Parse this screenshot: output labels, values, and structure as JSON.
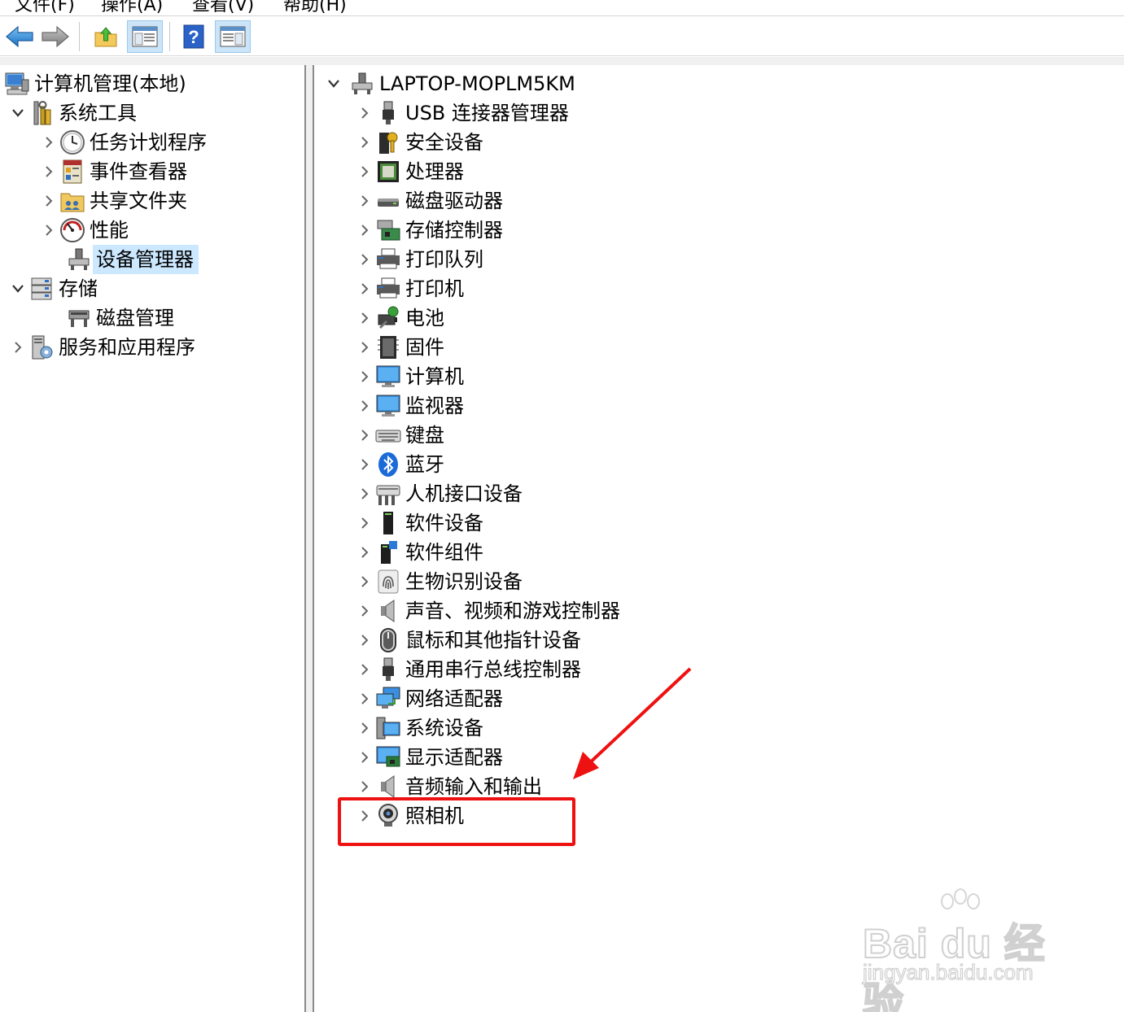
{
  "menu": {
    "items": [
      "文件(F)",
      "操作(A)",
      "查看(V)",
      "帮助(H)"
    ]
  },
  "toolbar": {
    "buttons": [
      {
        "icon": "back-arrow-icon",
        "pressed": false
      },
      {
        "icon": "forward-arrow-icon",
        "pressed": false
      },
      {
        "icon": "up-folder-icon",
        "pressed": false
      },
      {
        "icon": "show-hide-tree-icon",
        "pressed": true
      },
      {
        "icon": "help-icon",
        "pressed": false
      },
      {
        "icon": "action-pane-icon",
        "pressed": true
      }
    ]
  },
  "left_tree": {
    "root": "计算机管理(本地)",
    "system_tools": "系统工具",
    "task_scheduler": "任务计划程序",
    "event_viewer": "事件查看器",
    "shared_folders": "共享文件夹",
    "performance": "性能",
    "device_manager": "设备管理器",
    "storage": "存储",
    "disk_management": "磁盘管理",
    "services_apps": "服务和应用程序",
    "selected": "设备管理器"
  },
  "device_tree": {
    "computer_name": "LAPTOP-MOPLM5KM",
    "categories": [
      {
        "label": "USB 连接器管理器",
        "icon": "usb-icon"
      },
      {
        "label": "安全设备",
        "icon": "security-key-icon"
      },
      {
        "label": "处理器",
        "icon": "processor-icon"
      },
      {
        "label": "磁盘驱动器",
        "icon": "disk-drive-icon"
      },
      {
        "label": "存储控制器",
        "icon": "storage-controller-icon"
      },
      {
        "label": "打印队列",
        "icon": "print-queue-icon"
      },
      {
        "label": "打印机",
        "icon": "printer-icon"
      },
      {
        "label": "电池",
        "icon": "battery-icon"
      },
      {
        "label": "固件",
        "icon": "firmware-icon"
      },
      {
        "label": "计算机",
        "icon": "computer-icon"
      },
      {
        "label": "监视器",
        "icon": "monitor-icon"
      },
      {
        "label": "键盘",
        "icon": "keyboard-icon"
      },
      {
        "label": "蓝牙",
        "icon": "bluetooth-icon"
      },
      {
        "label": "人机接口设备",
        "icon": "hid-icon"
      },
      {
        "label": "软件设备",
        "icon": "software-device-icon"
      },
      {
        "label": "软件组件",
        "icon": "software-component-icon"
      },
      {
        "label": "生物识别设备",
        "icon": "fingerprint-icon"
      },
      {
        "label": "声音、视频和游戏控制器",
        "icon": "speaker-icon"
      },
      {
        "label": "鼠标和其他指针设备",
        "icon": "mouse-icon"
      },
      {
        "label": "通用串行总线控制器",
        "icon": "usb-controller-icon"
      },
      {
        "label": "网络适配器",
        "icon": "network-adapter-icon"
      },
      {
        "label": "系统设备",
        "icon": "system-device-icon"
      },
      {
        "label": "显示适配器",
        "icon": "display-adapter-icon"
      },
      {
        "label": "音频输入和输出",
        "icon": "audio-io-icon"
      },
      {
        "label": "照相机",
        "icon": "camera-icon"
      }
    ],
    "highlighted": "照相机"
  },
  "annotation": {
    "color": "#ee1111"
  },
  "watermark": {
    "main": "Bai du 经验",
    "sub": "jingyan.baidu.com"
  },
  "colors": {
    "selection": "#cce8ff",
    "toolbar_pressed": "#cce4f7",
    "splitter": "#f0f0f0"
  }
}
